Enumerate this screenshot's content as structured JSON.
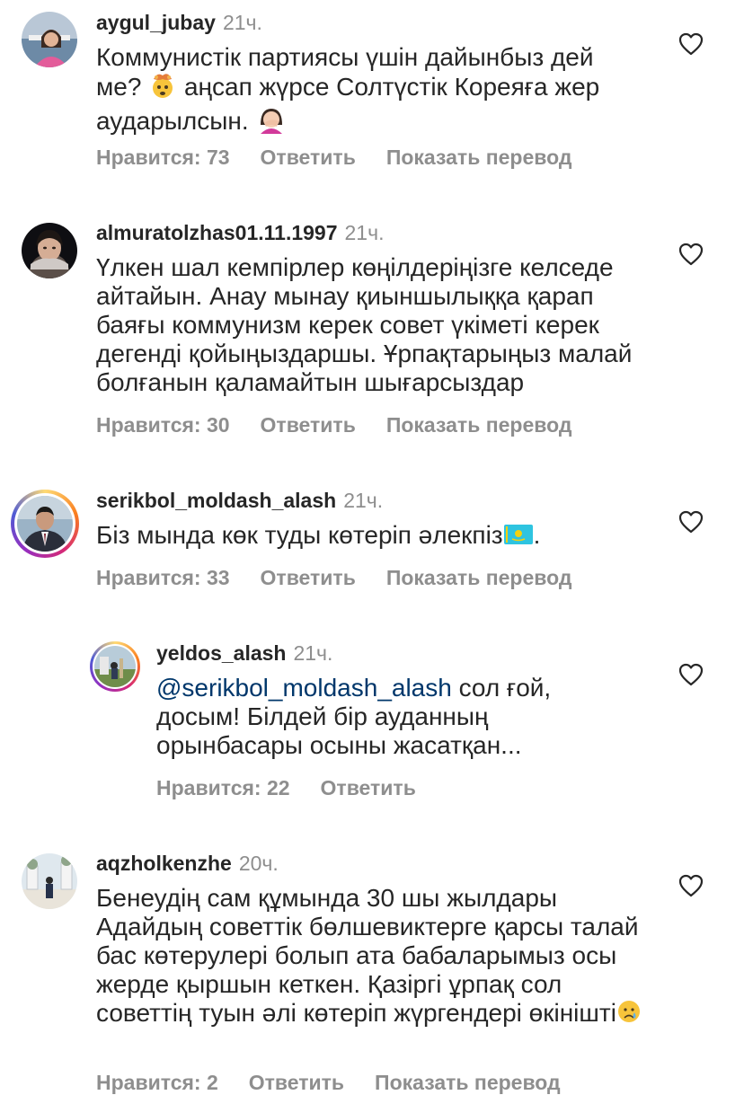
{
  "comments": [
    {
      "username": "aygul_jubay",
      "time": "21ч.",
      "text_parts": [
        "Коммунистік партиясы үшін дайынбыз дей ме? ",
        " аңсап жүрсе Солтүстік Кореяға жер аударылсын. "
      ],
      "likes": "Нравится: 73",
      "reply": "Ответить",
      "translate": "Показать перевод",
      "emojis": [
        "exploding-head",
        "woman-facepalming"
      ]
    },
    {
      "username": "almuratolzhas01.11.1997",
      "time": "21ч.",
      "text": "Үлкен шал кемпірлер көңілдеріңізге келседе айтайын. Анау мынау қиыншылыққа қарап баяғы коммунизм керек совет үкіметі керек дегенді қойыңыздаршы. Ұрпақтарыңыз малай болғанын қаламайтын шығарсыздар",
      "likes": "Нравится: 30",
      "reply": "Ответить",
      "translate": "Показать перевод"
    },
    {
      "username": "serikbol_moldash_alash",
      "time": "21ч.",
      "text": "Біз мында көк туды көтеріп әлекпіз",
      "text_end": ".",
      "likes": "Нравится: 33",
      "reply": "Ответить",
      "translate": "Показать перевод",
      "emojis": [
        "kazakhstan-flag"
      ]
    },
    {
      "username": "yeldos_alash",
      "time": "21ч.",
      "mention": "@serikbol_moldash_alash",
      "text": " сол ғой, досым! Білдей бір ауданның орынбасары осыны жасатқан...",
      "likes": "Нравится: 22",
      "reply": "Ответить"
    },
    {
      "username": "aqzholkenzhe",
      "time": "20ч.",
      "text": "Бенеудің сам құмында 30 шы жылдары Адайдың советтік бөлшевиктерге қарсы талай бас көтерулері болып ата бабаларымыз осы жерде қыршын кеткен. Қазіргі ұрпақ сол советтің туын әлі көтеріп жүргендері өкінішті",
      "likes": "Нравится: 2",
      "reply": "Ответить",
      "translate": "Показать перевод",
      "emojis": [
        "crying-face"
      ]
    }
  ],
  "colors": {
    "text": "#262626",
    "muted": "#8e8e8e",
    "mention": "#00376b"
  }
}
